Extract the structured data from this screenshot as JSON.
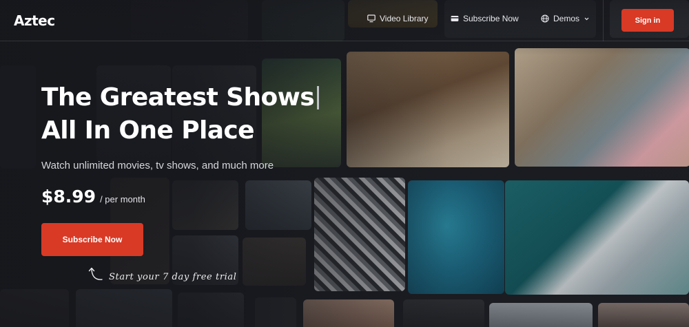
{
  "header": {
    "logo": "Aztec",
    "nav": [
      {
        "label": "Video Library",
        "icon": "monitor-icon"
      },
      {
        "label": "Subscribe Now",
        "icon": "credit-card-icon"
      },
      {
        "label": "Demos",
        "icon": "globe-icon",
        "dropdown_icon": "chevron-down-icon"
      }
    ],
    "signin_label": "Sign in"
  },
  "hero": {
    "title_line1": "The Greatest Shows",
    "title_line2": "All In One Place",
    "subtitle": "Watch unlimited movies, tv shows, and much more",
    "price": "$8.99",
    "price_period": "/ per month",
    "cta_label": "Subscribe Now",
    "trial_note": "Start your 7 day free trial"
  },
  "colors": {
    "accent": "#d83a26",
    "background": "#1b1d22",
    "text": "#ffffff"
  }
}
